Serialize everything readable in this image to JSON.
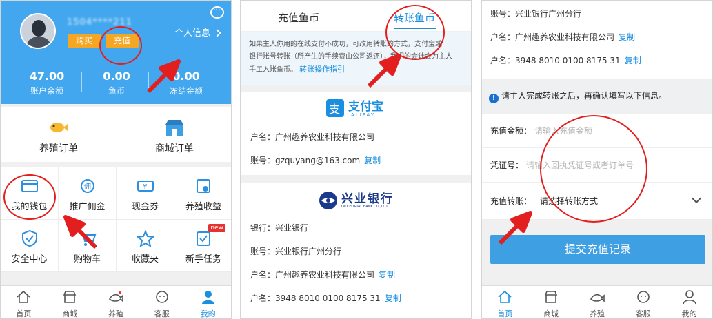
{
  "panel1": {
    "username": "1504****211",
    "buy_label": "购买",
    "recharge_label": "充值",
    "profile_label": "个人信息",
    "stats": [
      {
        "value": "47.00",
        "label": "账户余额"
      },
      {
        "value": "0.00",
        "label": "鱼币"
      },
      {
        "value": "0.00",
        "label": "冻结金额"
      }
    ],
    "orders": [
      {
        "label": "养殖订单",
        "icon": "fish-icon"
      },
      {
        "label": "商城订单",
        "icon": "shop-icon"
      }
    ],
    "grid": [
      {
        "label": "我的钱包",
        "icon": "wallet-icon"
      },
      {
        "label": "推广佣金",
        "icon": "commission-icon"
      },
      {
        "label": "现金券",
        "icon": "coupon-icon"
      },
      {
        "label": "养殖收益",
        "icon": "income-icon"
      },
      {
        "label": "安全中心",
        "icon": "shield-icon"
      },
      {
        "label": "购物车",
        "icon": "cart-icon"
      },
      {
        "label": "收藏夹",
        "icon": "star-icon"
      },
      {
        "label": "新手任务",
        "icon": "task-icon",
        "badge": "new"
      }
    ],
    "tabs": [
      {
        "label": "首页",
        "icon": "home-icon"
      },
      {
        "label": "商城",
        "icon": "store-icon"
      },
      {
        "label": "养殖",
        "icon": "fish-farm-icon"
      },
      {
        "label": "客服",
        "icon": "service-icon"
      },
      {
        "label": "我的",
        "icon": "user-icon",
        "active": true
      }
    ]
  },
  "panel2": {
    "tab1": "充值鱼币",
    "tab2": "转账鱼币",
    "notice_line1": "如果主人你用的在线支付不成功，可改用转账的方式，支付宝或",
    "notice_line2": "银行账号转账（所产生的手续费由公司返还），我们的会计会为主人",
    "notice_line3": "手工入账鱼币。",
    "guide_link": "转账操作指引",
    "alipay_name": "支付宝",
    "alipay_sub": "ALIPAY",
    "alipay_holder": "户名：广州趣养农业科技有限公司",
    "alipay_account": "账号：gzquyang@163.com",
    "copy_label": "复制",
    "bank_name": "兴业银行",
    "bank_sub": "INDUSTRIAL BANK CO.,LTD.",
    "bank_row": "银行：兴业银行",
    "bank_account_row": "账号：兴业银行广州分行",
    "bank_holder": "户名：广州趣养农业科技有限公司",
    "bank_number": "户名：3948 8010 0100 8175 31"
  },
  "panel3": {
    "account_row": "账号：兴业银行广州分行",
    "holder_row": "户名：广州趣养农业科技有限公司",
    "number_row": "户名：3948 8010 0100 8175 31",
    "copy_label": "复制",
    "tip": "请主人完成转账之后，再确认填写以下信息。",
    "amount_label": "充值金额：",
    "amount_placeholder": "请输入充值金额",
    "voucher_label": "凭证号：",
    "voucher_placeholder": "请输入回执凭证号或者订单号",
    "method_label": "充值转账：",
    "method_value": "请选择转账方式",
    "submit_label": "提交充值记录",
    "tabs": [
      {
        "label": "首页",
        "icon": "home-icon",
        "active": true
      },
      {
        "label": "商城",
        "icon": "store-icon"
      },
      {
        "label": "养殖",
        "icon": "fish-farm-icon"
      },
      {
        "label": "客服",
        "icon": "service-icon"
      },
      {
        "label": "我的",
        "icon": "user-icon"
      }
    ]
  },
  "colors": {
    "brand_blue": "#42a7ee",
    "link_blue": "#1a8fe0",
    "orange": "#f5a623",
    "annotation_red": "#e31e1e"
  }
}
